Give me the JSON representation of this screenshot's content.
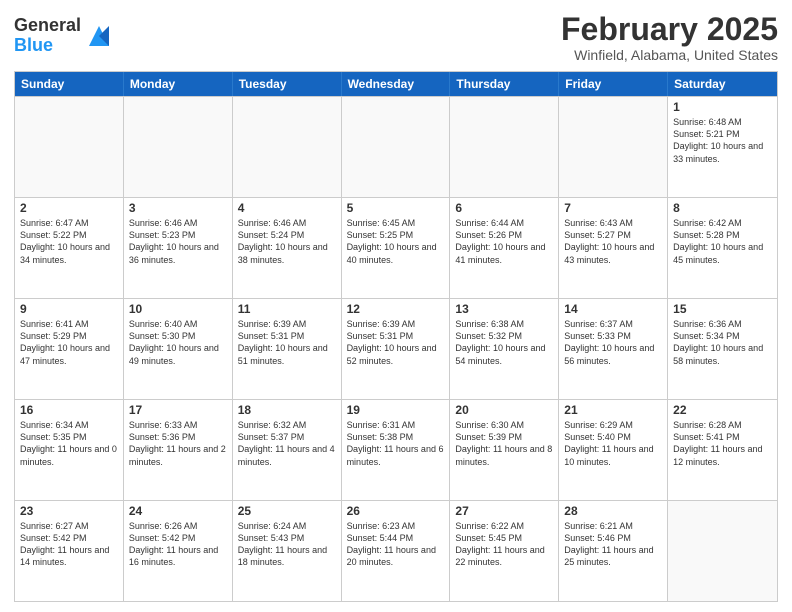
{
  "header": {
    "logo_general": "General",
    "logo_blue": "Blue",
    "month_title": "February 2025",
    "location": "Winfield, Alabama, United States"
  },
  "days_of_week": [
    "Sunday",
    "Monday",
    "Tuesday",
    "Wednesday",
    "Thursday",
    "Friday",
    "Saturday"
  ],
  "weeks": [
    [
      {
        "day": "",
        "text": ""
      },
      {
        "day": "",
        "text": ""
      },
      {
        "day": "",
        "text": ""
      },
      {
        "day": "",
        "text": ""
      },
      {
        "day": "",
        "text": ""
      },
      {
        "day": "",
        "text": ""
      },
      {
        "day": "1",
        "text": "Sunrise: 6:48 AM\nSunset: 5:21 PM\nDaylight: 10 hours and 33 minutes."
      }
    ],
    [
      {
        "day": "2",
        "text": "Sunrise: 6:47 AM\nSunset: 5:22 PM\nDaylight: 10 hours and 34 minutes."
      },
      {
        "day": "3",
        "text": "Sunrise: 6:46 AM\nSunset: 5:23 PM\nDaylight: 10 hours and 36 minutes."
      },
      {
        "day": "4",
        "text": "Sunrise: 6:46 AM\nSunset: 5:24 PM\nDaylight: 10 hours and 38 minutes."
      },
      {
        "day": "5",
        "text": "Sunrise: 6:45 AM\nSunset: 5:25 PM\nDaylight: 10 hours and 40 minutes."
      },
      {
        "day": "6",
        "text": "Sunrise: 6:44 AM\nSunset: 5:26 PM\nDaylight: 10 hours and 41 minutes."
      },
      {
        "day": "7",
        "text": "Sunrise: 6:43 AM\nSunset: 5:27 PM\nDaylight: 10 hours and 43 minutes."
      },
      {
        "day": "8",
        "text": "Sunrise: 6:42 AM\nSunset: 5:28 PM\nDaylight: 10 hours and 45 minutes."
      }
    ],
    [
      {
        "day": "9",
        "text": "Sunrise: 6:41 AM\nSunset: 5:29 PM\nDaylight: 10 hours and 47 minutes."
      },
      {
        "day": "10",
        "text": "Sunrise: 6:40 AM\nSunset: 5:30 PM\nDaylight: 10 hours and 49 minutes."
      },
      {
        "day": "11",
        "text": "Sunrise: 6:39 AM\nSunset: 5:31 PM\nDaylight: 10 hours and 51 minutes."
      },
      {
        "day": "12",
        "text": "Sunrise: 6:39 AM\nSunset: 5:31 PM\nDaylight: 10 hours and 52 minutes."
      },
      {
        "day": "13",
        "text": "Sunrise: 6:38 AM\nSunset: 5:32 PM\nDaylight: 10 hours and 54 minutes."
      },
      {
        "day": "14",
        "text": "Sunrise: 6:37 AM\nSunset: 5:33 PM\nDaylight: 10 hours and 56 minutes."
      },
      {
        "day": "15",
        "text": "Sunrise: 6:36 AM\nSunset: 5:34 PM\nDaylight: 10 hours and 58 minutes."
      }
    ],
    [
      {
        "day": "16",
        "text": "Sunrise: 6:34 AM\nSunset: 5:35 PM\nDaylight: 11 hours and 0 minutes."
      },
      {
        "day": "17",
        "text": "Sunrise: 6:33 AM\nSunset: 5:36 PM\nDaylight: 11 hours and 2 minutes."
      },
      {
        "day": "18",
        "text": "Sunrise: 6:32 AM\nSunset: 5:37 PM\nDaylight: 11 hours and 4 minutes."
      },
      {
        "day": "19",
        "text": "Sunrise: 6:31 AM\nSunset: 5:38 PM\nDaylight: 11 hours and 6 minutes."
      },
      {
        "day": "20",
        "text": "Sunrise: 6:30 AM\nSunset: 5:39 PM\nDaylight: 11 hours and 8 minutes."
      },
      {
        "day": "21",
        "text": "Sunrise: 6:29 AM\nSunset: 5:40 PM\nDaylight: 11 hours and 10 minutes."
      },
      {
        "day": "22",
        "text": "Sunrise: 6:28 AM\nSunset: 5:41 PM\nDaylight: 11 hours and 12 minutes."
      }
    ],
    [
      {
        "day": "23",
        "text": "Sunrise: 6:27 AM\nSunset: 5:42 PM\nDaylight: 11 hours and 14 minutes."
      },
      {
        "day": "24",
        "text": "Sunrise: 6:26 AM\nSunset: 5:42 PM\nDaylight: 11 hours and 16 minutes."
      },
      {
        "day": "25",
        "text": "Sunrise: 6:24 AM\nSunset: 5:43 PM\nDaylight: 11 hours and 18 minutes."
      },
      {
        "day": "26",
        "text": "Sunrise: 6:23 AM\nSunset: 5:44 PM\nDaylight: 11 hours and 20 minutes."
      },
      {
        "day": "27",
        "text": "Sunrise: 6:22 AM\nSunset: 5:45 PM\nDaylight: 11 hours and 22 minutes."
      },
      {
        "day": "28",
        "text": "Sunrise: 6:21 AM\nSunset: 5:46 PM\nDaylight: 11 hours and 25 minutes."
      },
      {
        "day": "",
        "text": ""
      }
    ]
  ]
}
